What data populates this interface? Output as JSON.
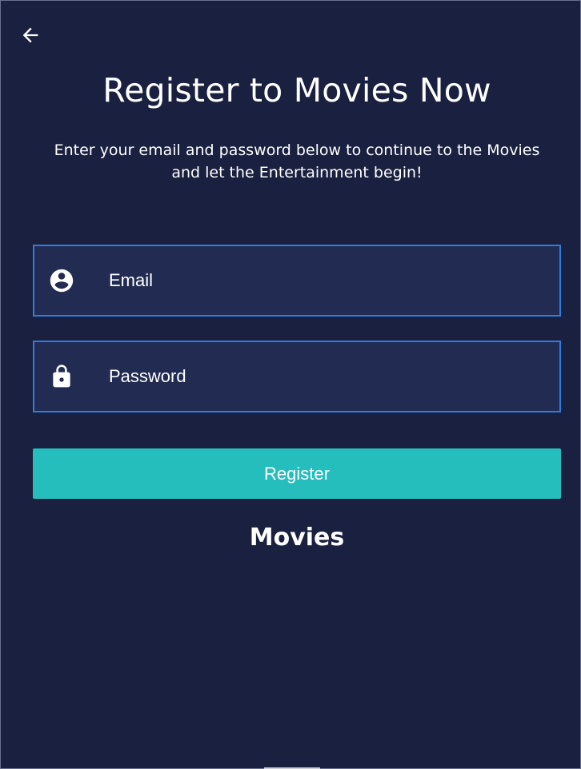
{
  "header": {
    "back_icon": "arrow-left-icon",
    "title": "Register to Movies Now",
    "subtitle": "Enter your email and password below to continue to the Movies and let the Entertainment begin!"
  },
  "form": {
    "email": {
      "icon": "account-circle-icon",
      "placeholder": "Email",
      "value": ""
    },
    "password": {
      "icon": "lock-icon",
      "placeholder": "Password",
      "value": ""
    },
    "register_label": "Register"
  },
  "footer": {
    "brand": "Movies"
  },
  "colors": {
    "background": "#1a2040",
    "field_background": "#222c53",
    "field_border": "#2d7de0",
    "button": "#26bdbd",
    "text": "#ffffff"
  }
}
